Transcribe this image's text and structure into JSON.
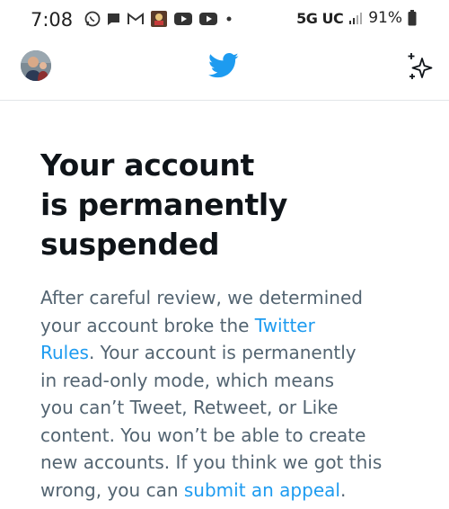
{
  "status_bar": {
    "time": "7:08",
    "network": "5G UC",
    "battery": "91%",
    "notification_icons": [
      "whatsapp-icon",
      "message-icon",
      "gmail-icon",
      "app-icon",
      "youtube-icon",
      "youtube-icon",
      "more-dot-icon"
    ]
  },
  "header": {
    "logo": "twitter-bird-icon",
    "right_icon": "sparkle-icon",
    "brand_color": "#1d9bf0"
  },
  "notice": {
    "title_lines": [
      "Your account",
      "is permanently",
      "suspended"
    ],
    "line1": "After careful review, we determined",
    "line2_prefix": "your account broke the ",
    "line2_link": "Twitter",
    "line3_link": "Rules",
    "line3_suffix": ". Your account is permanently",
    "line4": "in read-only mode, which means",
    "line5": "you can’t Tweet, Retweet, or Like",
    "line6": "content. You won’t be able to create",
    "line7": "new accounts. If you think we got this",
    "line8_prefix": "wrong, you can ",
    "line8_link": "submit an appeal",
    "line8_suffix": "."
  }
}
